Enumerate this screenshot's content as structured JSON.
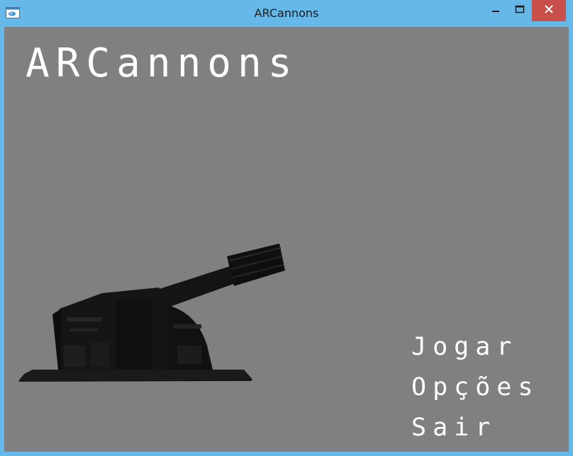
{
  "window": {
    "title": "ARCannons",
    "icon": "app-window-icon",
    "controls": {
      "minimize_icon": "minimize-icon",
      "maximize_icon": "maximize-icon",
      "close_icon": "close-icon"
    }
  },
  "game": {
    "title": "ARCannons",
    "menu": [
      {
        "label": "Jogar"
      },
      {
        "label": "Opções"
      },
      {
        "label": "Sair"
      }
    ],
    "illustration": "cannon-turret"
  },
  "colors": {
    "titlebar": "#66b8e8",
    "background": "#808080",
    "text": "#ffffff",
    "close_button": "#c9504a"
  }
}
